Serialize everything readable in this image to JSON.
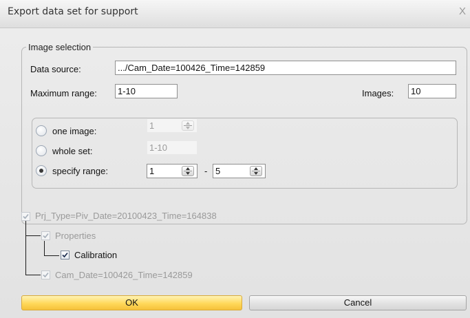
{
  "dialog": {
    "title": "Export data set for support",
    "close_glyph": "X"
  },
  "image_selection": {
    "legend": "Image selection",
    "data_source_label": "Data source:",
    "data_source_value": ".../Cam_Date=100426_Time=142859",
    "max_range_label": "Maximum range:",
    "max_range_value": "1-10",
    "images_label": "Images:",
    "images_value": "10"
  },
  "range_options": {
    "one_image": {
      "label": "one image:",
      "value": "1",
      "selected": false
    },
    "whole_set": {
      "label": "whole set:",
      "value": "1-10",
      "selected": false
    },
    "specify_range": {
      "label": "specify range:",
      "from": "1",
      "separator": "-",
      "to": "5",
      "selected": true
    }
  },
  "tree": {
    "root": {
      "label": "Prj_Type=Piv_Date=20100423_Time=164838",
      "checked": true,
      "enabled": false
    },
    "properties": {
      "label": "Properties",
      "checked": true,
      "enabled": false
    },
    "calibration": {
      "label": "Calibration",
      "checked": true,
      "enabled": true
    },
    "camera": {
      "label": "Cam_Date=100426_Time=142859",
      "checked": true,
      "enabled": false
    }
  },
  "buttons": {
    "ok": "OK",
    "cancel": "Cancel"
  }
}
